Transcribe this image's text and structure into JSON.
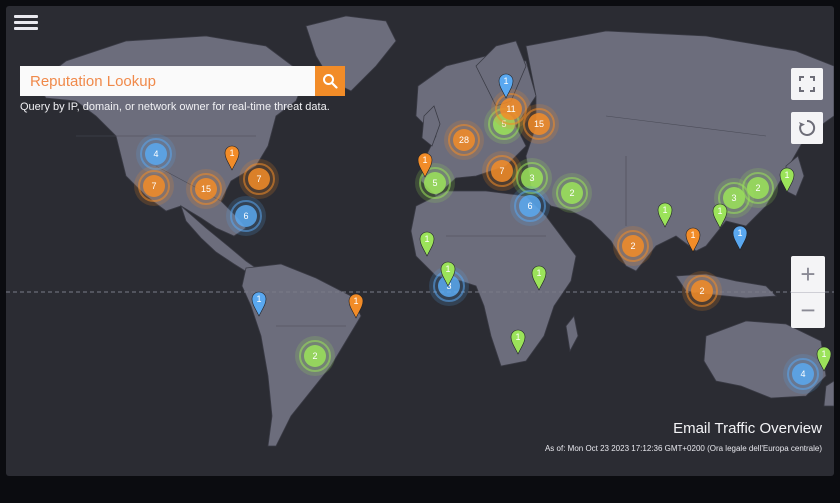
{
  "search": {
    "placeholder": "Reputation Lookup",
    "hint": "Query by IP, domain, or network owner for real-time threat data."
  },
  "controls": {
    "zoom_in": "+",
    "zoom_out": "−"
  },
  "footer": {
    "title": "Email Traffic Overview",
    "timestamp_prefix": "As of:",
    "timestamp": "Mon Oct 23 2023 17:12:36 GMT+0200 (Ora legale dell'Europa centrale)"
  },
  "colors": {
    "orange": "#f28c28",
    "green": "#9be35a",
    "blue": "#5aa8f0",
    "red": "#f0502a"
  },
  "icons": [
    "menu-icon",
    "search-icon",
    "fullscreen-icon",
    "refresh-icon"
  ],
  "clusters": [
    {
      "count": "4",
      "color": "blue"
    },
    {
      "count": "7",
      "color": "orange"
    },
    {
      "count": "15",
      "color": "orange"
    },
    {
      "count": "7",
      "color": "orange"
    },
    {
      "count": "6",
      "color": "blue"
    },
    {
      "count": "5",
      "color": "green"
    },
    {
      "count": "28",
      "color": "orange"
    },
    {
      "count": "11",
      "color": "orange"
    },
    {
      "count": "15",
      "color": "orange"
    },
    {
      "count": "5",
      "color": "green"
    },
    {
      "count": "7",
      "color": "orange"
    },
    {
      "count": "3",
      "color": "green"
    },
    {
      "count": "2",
      "color": "green"
    },
    {
      "count": "6",
      "color": "blue"
    },
    {
      "count": "3",
      "color": "green"
    },
    {
      "count": "2",
      "color": "green"
    },
    {
      "count": "2",
      "color": "orange"
    },
    {
      "count": "3",
      "color": "blue"
    },
    {
      "count": "2",
      "color": "orange"
    },
    {
      "count": "2",
      "color": "green"
    },
    {
      "count": "4",
      "color": "blue"
    }
  ],
  "pins": [
    {
      "count": "1",
      "color": "orange"
    },
    {
      "count": "1",
      "color": "orange"
    },
    {
      "count": "1",
      "color": "blue"
    },
    {
      "count": "1",
      "color": "green"
    },
    {
      "count": "1",
      "color": "green"
    },
    {
      "count": "1",
      "color": "green"
    },
    {
      "count": "1",
      "color": "green"
    },
    {
      "count": "1",
      "color": "blue"
    },
    {
      "count": "1",
      "color": "orange"
    },
    {
      "count": "1",
      "color": "green"
    },
    {
      "count": "1",
      "color": "green"
    },
    {
      "count": "1",
      "color": "orange"
    },
    {
      "count": "1",
      "color": "blue"
    },
    {
      "count": "1",
      "color": "green"
    },
    {
      "count": "1",
      "color": "green"
    }
  ]
}
